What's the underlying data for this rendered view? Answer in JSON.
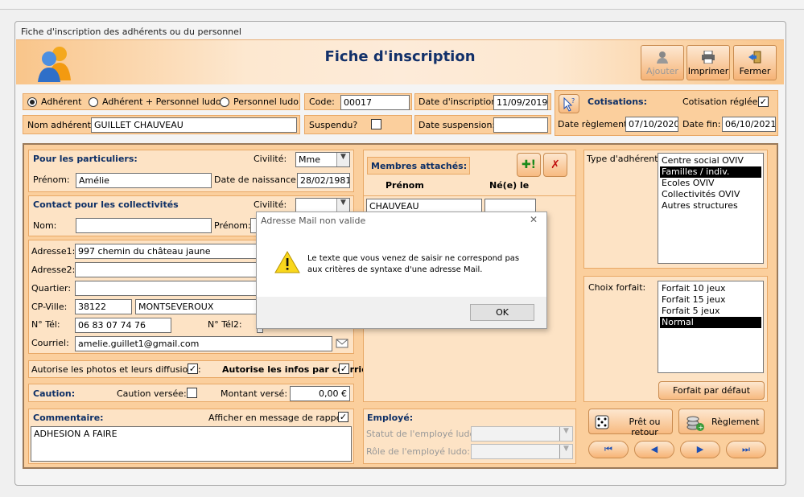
{
  "window": {
    "title": "Fiche d'inscription des adhérents ou du personnel"
  },
  "header": {
    "title": "Fiche d'inscription",
    "buttons": {
      "add": "Ajouter",
      "print": "Imprimer",
      "close": "Fermer"
    }
  },
  "type_radio": {
    "adherent": "Adhérent",
    "adherent_perso": "Adhérent + Personnel ludo",
    "personnel": "Personnel ludo",
    "selected": "Adhérent"
  },
  "code": {
    "label": "Code:",
    "value": "00017"
  },
  "date_inscription": {
    "label": "Date d'inscription:",
    "value": "11/09/2019"
  },
  "nom_adherent": {
    "label": "Nom adhérent:",
    "value": "GUILLET CHAUVEAU"
  },
  "suspendu": {
    "label": "Suspendu?",
    "checked": false
  },
  "date_suspension": {
    "label": "Date  suspension:",
    "value": ""
  },
  "cotisations": {
    "title": "Cotisations:",
    "reglee_label": "Cotisation réglée:",
    "reglee": true,
    "date_reglement_label": "Date règlement:",
    "date_reglement": "07/10/2020",
    "date_fin_label": "Date fin:",
    "date_fin": "06/10/2021"
  },
  "particuliers": {
    "title": "Pour les particuliers:",
    "civilite_label": "Civilité:",
    "civilite": "Mme",
    "prenom_label": "Prénom:",
    "prenom": "Amélie",
    "naissance_label": "Date de naissance:",
    "naissance": "28/02/1981"
  },
  "collectivites": {
    "title": "Contact pour les collectivités",
    "civilite_label": "Civilité:",
    "nom_label": "Nom:",
    "prenom_label": "Prénom:"
  },
  "adresse": {
    "adresse1_label": "Adresse1:",
    "adresse1": "997 chemin du château jaune",
    "adresse2_label": "Adresse2:",
    "quartier_label": "Quartier:",
    "cp_ville_label": "CP-Ville:",
    "cp": "38122",
    "ville": "MONTSEVEROUX",
    "tel_label": "N° Tél:",
    "tel": "06 83 07 74 76",
    "tel2_label": "N° Tél2:",
    "courriel_label": "Courriel:",
    "courriel": "amelie.guillet1@gmail.com"
  },
  "autorisations": {
    "photos_label": "Autorise les photos et leurs diffusions:",
    "photos": true,
    "infos_label": "Autorise les infos par courriel:",
    "infos": true
  },
  "caution": {
    "title": "Caution:",
    "versee_label": "Caution versée:",
    "versee": false,
    "montant_label": "Montant versé:",
    "montant": "0,00 €"
  },
  "commentaire": {
    "title": "Commentaire:",
    "rappel_label": "Afficher en message de rappel",
    "rappel": true,
    "text": "ADHESION A FAIRE"
  },
  "membres": {
    "title": "Membres attachés:",
    "col_prenom": "Prénom",
    "col_ne": "Né(e) le",
    "rows": [
      "CHAUVEAU"
    ]
  },
  "employe": {
    "title": "Employé:",
    "statut_label": "Statut de l'employé ludo:",
    "role_label": "Rôle de l'employé ludo:"
  },
  "type_adherent": {
    "label": "Type d'adhérent:",
    "items": [
      "Centre social OVIV",
      "Familles / indiv.",
      "Ecoles OVIV",
      "Collectivités OVIV",
      "Autres structures"
    ],
    "selected": "Familles / indiv."
  },
  "forfait": {
    "label": "Choix forfait:",
    "items": [
      "Forfait 10 jeux",
      "Forfait 15 jeux",
      "Forfait 5 jeux",
      "Normal"
    ],
    "selected": "Normal",
    "default_button": "Forfait par défaut"
  },
  "actions": {
    "pret": "Prêt ou retour",
    "reglement": "Règlement"
  },
  "nav": {
    "first": "⏮",
    "prev": "◀",
    "next": "▶",
    "last": "⏭"
  },
  "dialog": {
    "title": "Adresse Mail non valide",
    "message_line1": "Le texte que vous venez de saisir ne correspond pas",
    "message_line2": "aux critères de syntaxe d'une adresse Mail.",
    "ok": "OK",
    "close": "✕"
  },
  "colors": {
    "panel": "#fbcf9d",
    "title_blue": "#13316a",
    "border_orange": "#e8a866"
  }
}
